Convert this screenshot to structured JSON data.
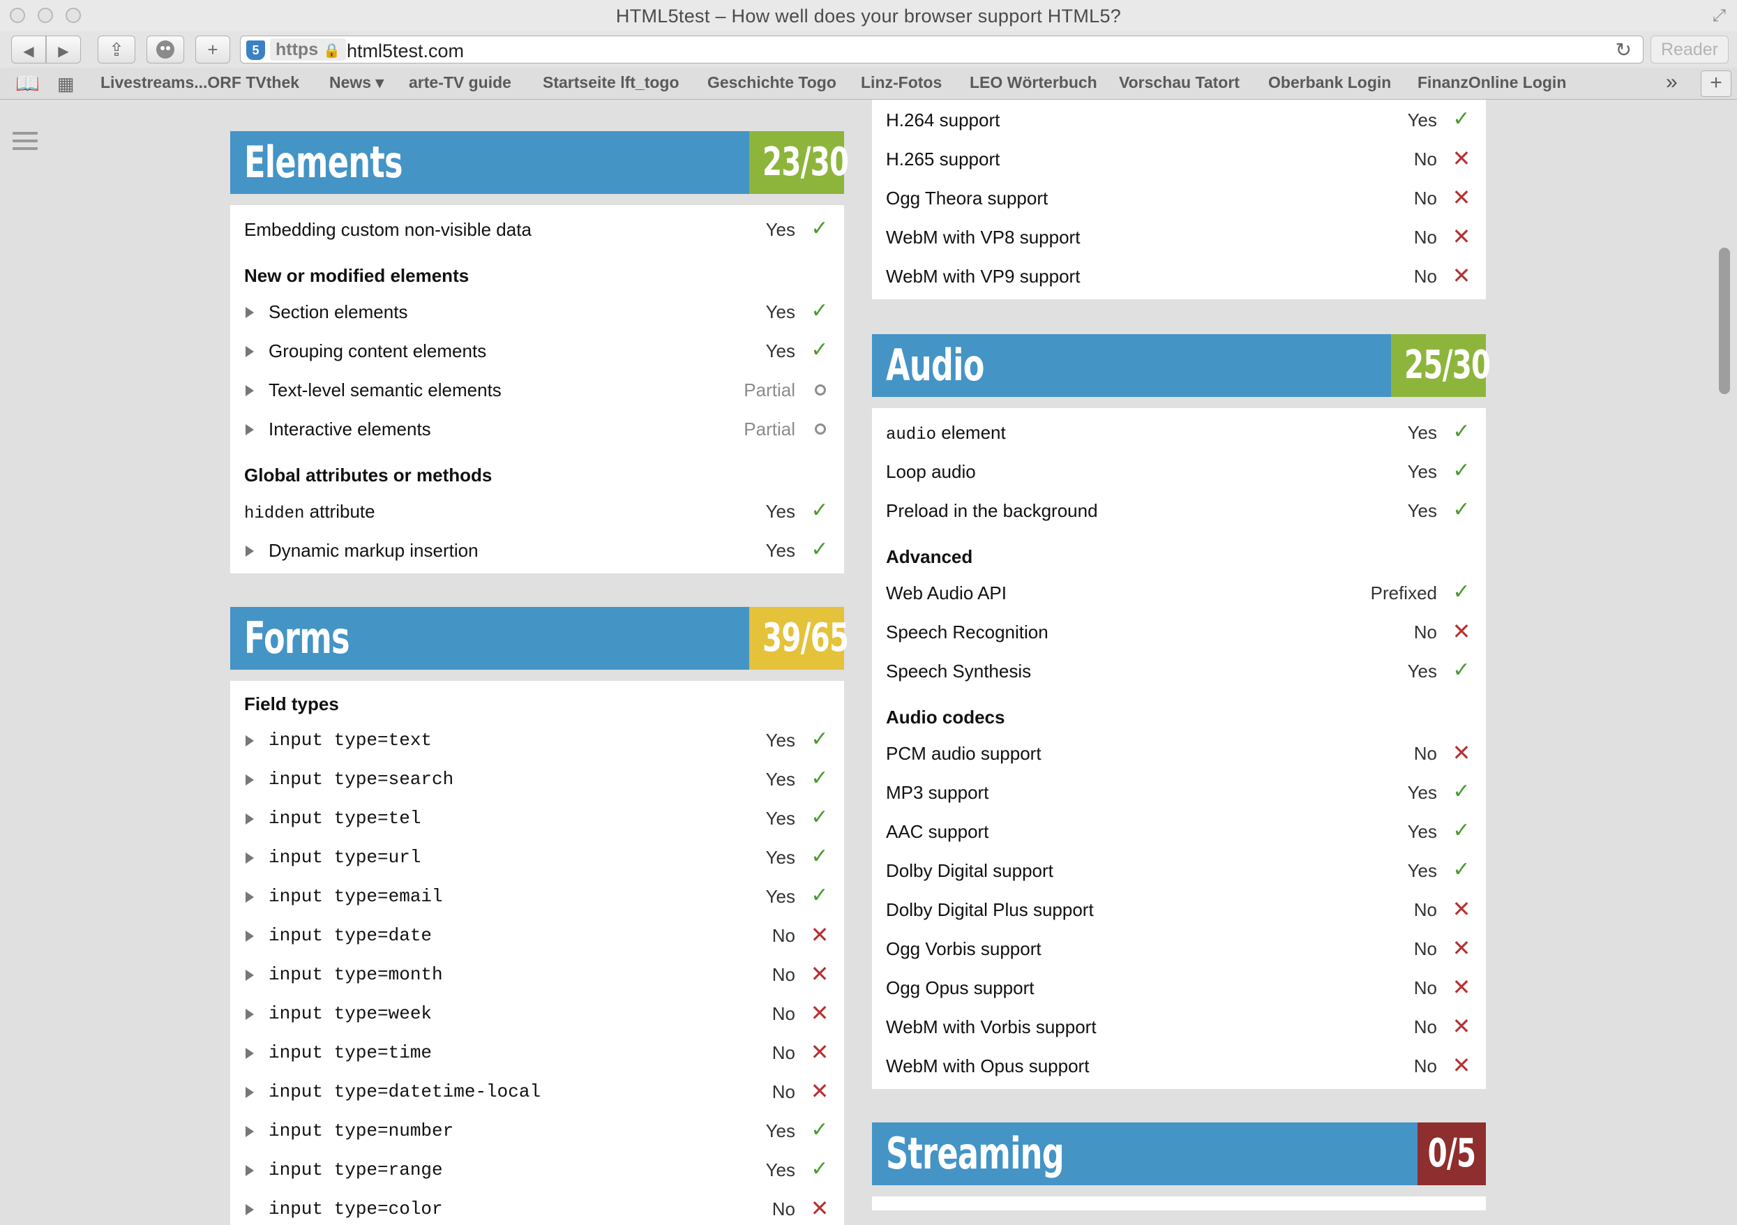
{
  "window": {
    "title": "HTML5test – How well does your browser support HTML5?"
  },
  "toolbar": {
    "back": "◀",
    "forward": "▶",
    "share": "⇪",
    "plus": "+",
    "url_scheme": "https",
    "url": "html5test.com",
    "reader": "Reader"
  },
  "bookmarks": [
    "Livestreams...ORF TVthek",
    "News ▾",
    "arte-TV guide",
    "Startseite lft_togo",
    "Geschichte Togo",
    "Linz-Fotos",
    "LEO Wörterbuch",
    "Vorschau Tatort",
    "Oberbank Login",
    "FinanzOnline Login"
  ],
  "colors": {
    "header_blue": "#4494c6",
    "score_green": "#8db53c",
    "score_yellow": "#e4c23a",
    "score_red": "#8e2e2e",
    "yes": "#4a9b2f",
    "no": "#b53232"
  },
  "video_rows": [
    {
      "label": "H.264 support",
      "status": "Yes"
    },
    {
      "label": "H.265 support",
      "status": "No"
    },
    {
      "label": "Ogg Theora support",
      "status": "No"
    },
    {
      "label": "WebM with VP8 support",
      "status": "No"
    },
    {
      "label": "WebM with VP9 support",
      "status": "No"
    }
  ],
  "elements": {
    "title": "Elements",
    "score": "23/30",
    "row0": {
      "label": "Embedding custom non-visible data",
      "status": "Yes"
    },
    "sub1": "New or modified elements",
    "rows1": [
      {
        "label": "Section elements",
        "status": "Yes"
      },
      {
        "label": "Grouping content elements",
        "status": "Yes"
      },
      {
        "label": "Text-level semantic elements",
        "status": "Partial"
      },
      {
        "label": "Interactive elements",
        "status": "Partial"
      }
    ],
    "sub2": "Global attributes or methods",
    "hidden_code": "hidden",
    "hidden_text": " attribute",
    "hidden_status": "Yes",
    "dyn": {
      "label": "Dynamic markup insertion",
      "status": "Yes"
    }
  },
  "forms": {
    "title": "Forms",
    "score": "39/65",
    "sub1": "Field types",
    "rows": [
      {
        "label": "input type=text",
        "status": "Yes"
      },
      {
        "label": "input type=search",
        "status": "Yes"
      },
      {
        "label": "input type=tel",
        "status": "Yes"
      },
      {
        "label": "input type=url",
        "status": "Yes"
      },
      {
        "label": "input type=email",
        "status": "Yes"
      },
      {
        "label": "input type=date",
        "status": "No"
      },
      {
        "label": "input type=month",
        "status": "No"
      },
      {
        "label": "input type=week",
        "status": "No"
      },
      {
        "label": "input type=time",
        "status": "No"
      },
      {
        "label": "input type=datetime-local",
        "status": "No"
      },
      {
        "label": "input type=number",
        "status": "Yes"
      },
      {
        "label": "input type=range",
        "status": "Yes"
      },
      {
        "label": "input type=color",
        "status": "No"
      }
    ]
  },
  "audio": {
    "title": "Audio",
    "score": "25/30",
    "audio_code": "audio",
    "audio_text": " element",
    "audio_status": "Yes",
    "rows0": [
      {
        "label": "Loop audio",
        "status": "Yes"
      },
      {
        "label": "Preload in the background",
        "status": "Yes"
      }
    ],
    "sub1": "Advanced",
    "rows1": [
      {
        "label": "Web Audio API",
        "status": "Prefixed"
      },
      {
        "label": "Speech Recognition",
        "status": "No"
      },
      {
        "label": "Speech Synthesis",
        "status": "Yes"
      }
    ],
    "sub2": "Audio codecs",
    "rows2": [
      {
        "label": "PCM audio support",
        "status": "No"
      },
      {
        "label": "MP3 support",
        "status": "Yes"
      },
      {
        "label": "AAC support",
        "status": "Yes"
      },
      {
        "label": "Dolby Digital support",
        "status": "Yes"
      },
      {
        "label": "Dolby Digital Plus support",
        "status": "No"
      },
      {
        "label": "Ogg Vorbis support",
        "status": "No"
      },
      {
        "label": "Ogg Opus support",
        "status": "No"
      },
      {
        "label": "WebM with Vorbis support",
        "status": "No"
      },
      {
        "label": "WebM with Opus support",
        "status": "No"
      }
    ]
  },
  "streaming": {
    "title": "Streaming",
    "score": "0/5"
  }
}
